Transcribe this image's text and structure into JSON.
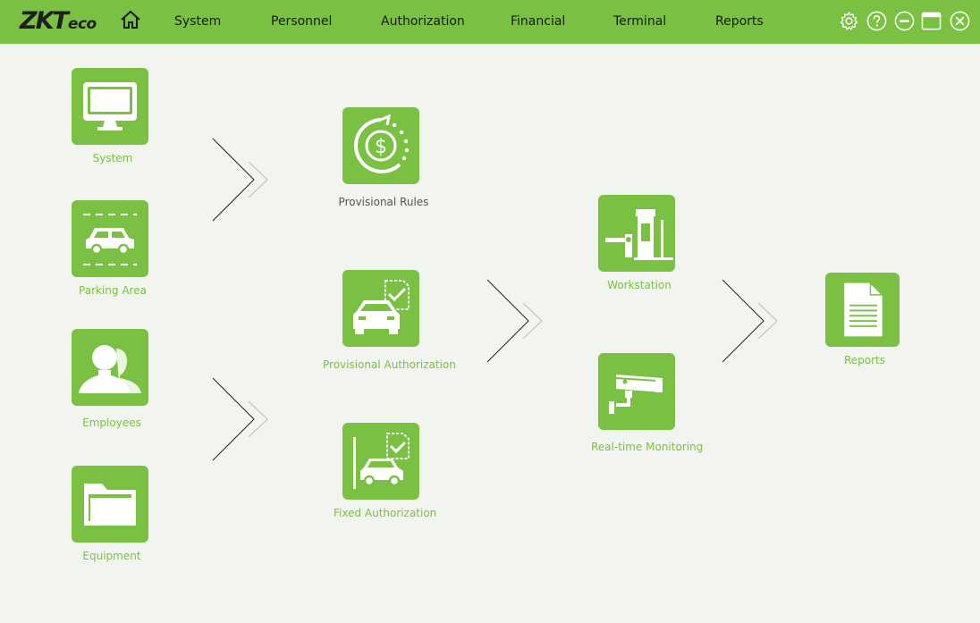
{
  "app": {
    "logo_main": "ZKT",
    "logo_sub": "eco"
  },
  "nav": {
    "items": [
      "System",
      "Personnel",
      "Authorization",
      "Financial",
      "Terminal",
      "Reports"
    ]
  },
  "window_controls": [
    "settings-icon",
    "help-icon",
    "minimize-icon",
    "maximize-icon",
    "close-icon"
  ],
  "tiles": {
    "system": "System",
    "parking_area": "Parking Area",
    "employees": "Employees",
    "equipment": "Equipment",
    "provisional_rules": "Provisional Rules",
    "provisional_authorization": "Provisional Authorization",
    "fixed_authorization": "Fixed Authorization",
    "workstation": "Workstation",
    "realtime_monitoring": "Real-time Monitoring",
    "reports": "Reports"
  },
  "colors": {
    "accent": "#7ac143",
    "background": "#f2f4f0",
    "label_dark": "#555555"
  }
}
